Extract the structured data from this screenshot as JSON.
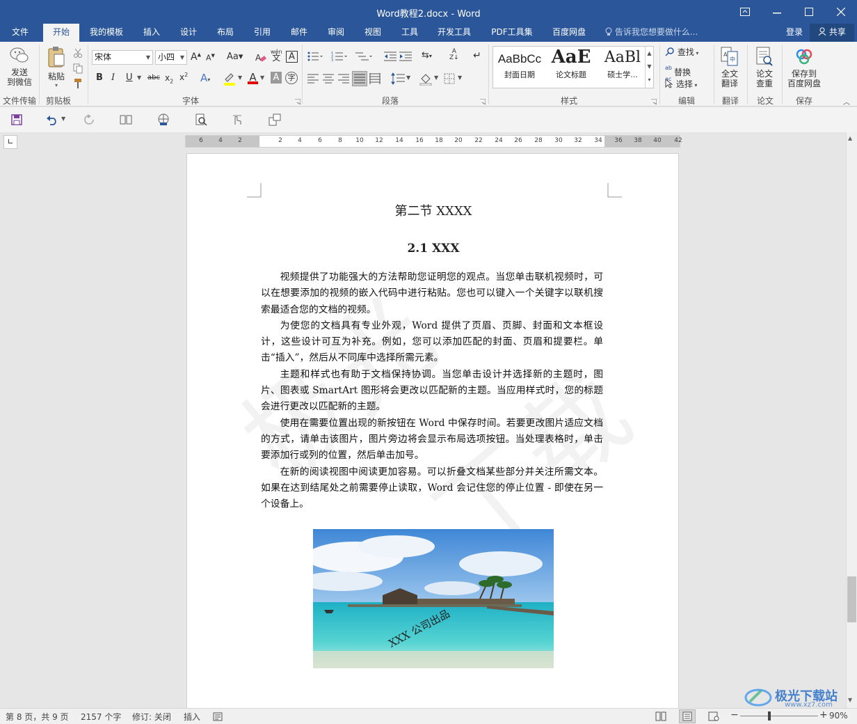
{
  "window": {
    "title": "Word教程2.docx - Word"
  },
  "tabs": [
    "文件",
    "开始",
    "我的模板",
    "插入",
    "设计",
    "布局",
    "引用",
    "邮件",
    "审阅",
    "视图",
    "工具",
    "开发工具",
    "PDF工具集",
    "百度网盘"
  ],
  "tell_me": "告诉我您想要做什么...",
  "account": {
    "login": "登录",
    "share": "共享"
  },
  "ribbon": {
    "send_wechat": "发送\n到微信",
    "paste": "粘贴",
    "font_name": "宋体",
    "font_size": "小四",
    "styles": [
      {
        "preview": "AaBbCc",
        "label": "封面日期"
      },
      {
        "preview": "AaE",
        "label": "论文标题"
      },
      {
        "preview": "AaBl",
        "label": "硕士学..."
      }
    ],
    "find": "查找",
    "replace": "替换",
    "select": "选择",
    "full_translate": "全文\n翻译",
    "paper_check": "论文\n查重",
    "save_baidu": "保存到\n百度网盘",
    "groups": [
      "文件传输",
      "剪贴板",
      "字体",
      "段落",
      "样式",
      "编辑",
      "翻译",
      "论文",
      "保存"
    ]
  },
  "ruler_numbers": [
    "6",
    "4",
    "2",
    "2",
    "4",
    "6",
    "8",
    "10",
    "12",
    "14",
    "16",
    "18",
    "20",
    "22",
    "24",
    "26",
    "28",
    "30",
    "32",
    "34",
    "36",
    "38",
    "40",
    "42"
  ],
  "document": {
    "heading1": "第二节  XXXX",
    "heading2": "2.1 XXX",
    "paragraphs": [
      "视频提供了功能强大的方法帮助您证明您的观点。当您单击联机视频时，可以在想要添加的视频的嵌入代码中进行粘贴。您也可以键入一个关键字以联机搜索最适合您的文档的视频。",
      "为使您的文档具有专业外观，Word 提供了页眉、页脚、封面和文本框设计，这些设计可互为补充。例如，您可以添加匹配的封面、页眉和提要栏。单击“插入”，然后从不同库中选择所需元素。",
      "主题和样式也有助于文档保持协调。当您单击设计并选择新的主题时，图片、图表或 SmartArt 图形将会更改以匹配新的主题。当应用样式时，您的标题会进行更改以匹配新的主题。",
      "使用在需要位置出现的新按钮在 Word 中保存时间。若要更改图片适应文档的方式，请单击该图片，图片旁边将会显示布局选项按钮。当处理表格时，单击要添加行或列的位置，然后单击加号。",
      "在新的阅读视图中阅读更加容易。可以折叠文档某些部分并关注所需文本。如果在达到结尾处之前需要停止读取，Word 会记住您的停止位置 - 即使在另一个设备上。"
    ],
    "image_caption": "XXX 公司出品"
  },
  "status": {
    "page": "第 8 页，共 9 页",
    "words": "2157 个字",
    "track": "修订: 关闭",
    "mode": "插入",
    "zoom": "90%"
  },
  "site_badge": "极光下载站",
  "site_url": "www.xz7.com"
}
